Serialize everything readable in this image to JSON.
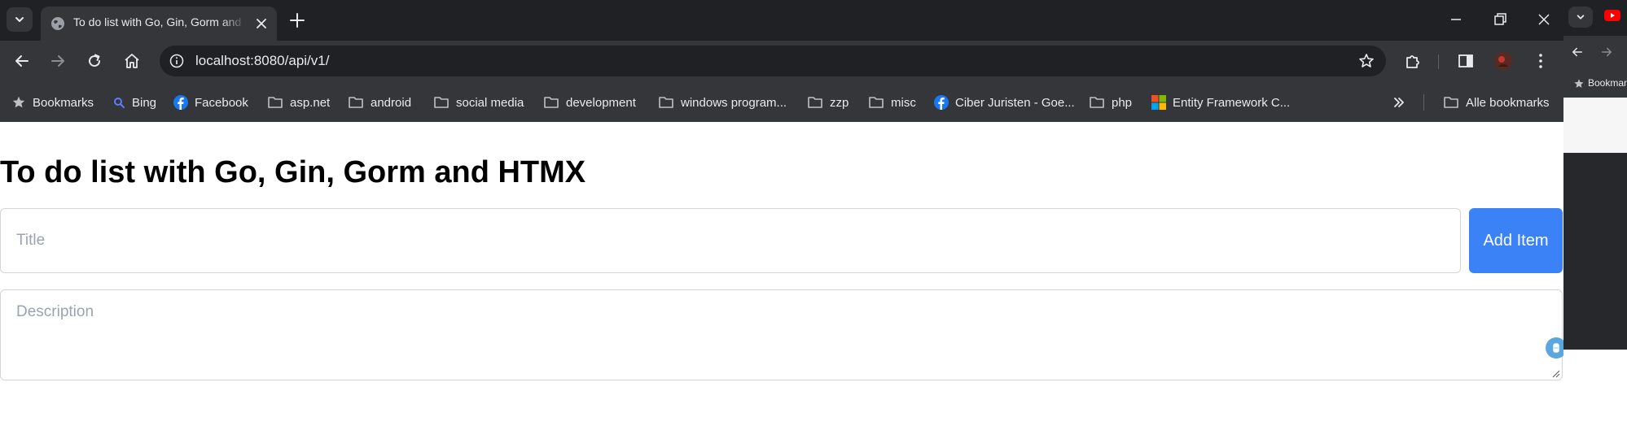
{
  "browser": {
    "tab": {
      "title": "To do list with Go, Gin, Gorm and HTMX"
    },
    "address_bar": {
      "url": "localhost:8080/api/v1/"
    },
    "bookmarks": [
      {
        "label": "Bookmarks",
        "icon": "star-icon"
      },
      {
        "label": "Bing",
        "icon": "bing-search-icon"
      },
      {
        "label": "Facebook",
        "icon": "facebook-icon"
      },
      {
        "label": "asp.net",
        "icon": "folder-icon"
      },
      {
        "label": "android",
        "icon": "folder-icon"
      },
      {
        "label": "social media",
        "icon": "folder-icon"
      },
      {
        "label": "development",
        "icon": "folder-icon"
      },
      {
        "label": "windows program...",
        "icon": "folder-icon"
      },
      {
        "label": "zzp",
        "icon": "folder-icon"
      },
      {
        "label": "misc",
        "icon": "folder-icon"
      },
      {
        "label": "Ciber Juristen - Goe...",
        "icon": "facebook-icon"
      },
      {
        "label": "php",
        "icon": "folder-icon"
      },
      {
        "label": "Entity Framework C...",
        "icon": "microsoft-icon"
      }
    ],
    "all_bookmarks_label": "Alle bookmarks",
    "colors": {
      "tabstrip": "#202124",
      "toolbar": "#35363a",
      "text": "#e8eaed"
    }
  },
  "page": {
    "heading": "To do list with Go, Gin, Gorm and HTMX",
    "title_input": {
      "placeholder": "Title",
      "value": ""
    },
    "add_button_label": "Add Item",
    "description_input": {
      "placeholder": "Description",
      "value": ""
    },
    "colors": {
      "accent": "#3b82f6",
      "border": "#d1d5db",
      "placeholder": "#9ca3af"
    }
  },
  "second_window": {
    "bookmarks_label": "Bookmarks"
  }
}
